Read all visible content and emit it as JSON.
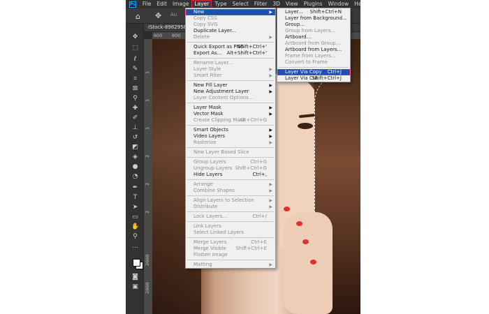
{
  "app": {
    "logo": "Ps",
    "menubar": [
      "File",
      "Edit",
      "Image",
      "Layer",
      "Type",
      "Select",
      "Filter",
      "3D",
      "View",
      "Plugins",
      "Window",
      "Help"
    ],
    "active_menu": "Layer"
  },
  "options_bar": {
    "auto_label": "Au"
  },
  "document": {
    "tab_label": "iStock-89829585",
    "ruler_marks": [
      "600",
      "800"
    ],
    "vruler_marks": [
      "1",
      "1",
      "1",
      "2",
      "2",
      "2",
      "2600",
      "2800"
    ]
  },
  "layer_menu": [
    {
      "label": "New",
      "arrow": "▶",
      "state": "selected"
    },
    {
      "label": "Copy CSS",
      "state": "disabled"
    },
    {
      "label": "Copy SVG",
      "state": "disabled"
    },
    {
      "label": "Duplicate Layer...",
      "state": "enabled"
    },
    {
      "label": "Delete",
      "arrow": "▶",
      "state": "disabled"
    },
    {
      "sep": true
    },
    {
      "label": "Quick Export as PNG",
      "shortcut": "Shift+Ctrl+'",
      "state": "enabled"
    },
    {
      "label": "Export As...",
      "shortcut": "Alt+Shift+Ctrl+'",
      "state": "enabled"
    },
    {
      "sep": true
    },
    {
      "label": "Rename Layer...",
      "state": "disabled"
    },
    {
      "label": "Layer Style",
      "arrow": "▶",
      "state": "disabled"
    },
    {
      "label": "Smart Filter",
      "arrow": "▶",
      "state": "disabled"
    },
    {
      "sep": true
    },
    {
      "label": "New Fill Layer",
      "arrow": "▶",
      "state": "enabled"
    },
    {
      "label": "New Adjustment Layer",
      "arrow": "▶",
      "state": "enabled"
    },
    {
      "label": "Layer Content Options...",
      "state": "disabled"
    },
    {
      "sep": true
    },
    {
      "label": "Layer Mask",
      "arrow": "▶",
      "state": "enabled"
    },
    {
      "label": "Vector Mask",
      "arrow": "▶",
      "state": "enabled"
    },
    {
      "label": "Create Clipping Mask",
      "shortcut": "Alt+Ctrl+G",
      "state": "disabled"
    },
    {
      "sep": true
    },
    {
      "label": "Smart Objects",
      "arrow": "▶",
      "state": "enabled"
    },
    {
      "label": "Video Layers",
      "arrow": "▶",
      "state": "enabled"
    },
    {
      "label": "Rasterize",
      "arrow": "▶",
      "state": "disabled"
    },
    {
      "sep": true
    },
    {
      "label": "New Layer Based Slice",
      "state": "disabled"
    },
    {
      "sep": true
    },
    {
      "label": "Group Layers",
      "shortcut": "Ctrl+G",
      "state": "disabled"
    },
    {
      "label": "Ungroup Layers",
      "shortcut": "Shift+Ctrl+G",
      "state": "disabled"
    },
    {
      "label": "Hide Layers",
      "shortcut": "Ctrl+,",
      "state": "enabled"
    },
    {
      "sep": true
    },
    {
      "label": "Arrange",
      "arrow": "▶",
      "state": "disabled"
    },
    {
      "label": "Combine Shapes",
      "arrow": "▶",
      "state": "disabled"
    },
    {
      "sep": true
    },
    {
      "label": "Align Layers to Selection",
      "arrow": "▶",
      "state": "disabled"
    },
    {
      "label": "Distribute",
      "arrow": "▶",
      "state": "disabled"
    },
    {
      "sep": true
    },
    {
      "label": "Lock Layers...",
      "shortcut": "Ctrl+/",
      "state": "disabled"
    },
    {
      "sep": true
    },
    {
      "label": "Link Layers",
      "state": "disabled"
    },
    {
      "label": "Select Linked Layers",
      "state": "disabled"
    },
    {
      "sep": true
    },
    {
      "label": "Merge Layers",
      "shortcut": "Ctrl+E",
      "state": "disabled"
    },
    {
      "label": "Merge Visible",
      "shortcut": "Shift+Ctrl+E",
      "state": "disabled"
    },
    {
      "label": "Flatten Image",
      "state": "disabled"
    },
    {
      "sep": true
    },
    {
      "label": "Matting",
      "arrow": "▶",
      "state": "disabled"
    }
  ],
  "new_menu": [
    {
      "label": "Layer...",
      "shortcut": "Shift+Ctrl+N",
      "state": "enabled"
    },
    {
      "label": "Layer from Background...",
      "state": "enabled"
    },
    {
      "label": "Group...",
      "state": "enabled"
    },
    {
      "label": "Group from Layers...",
      "state": "disabled"
    },
    {
      "label": "Artboard...",
      "state": "enabled"
    },
    {
      "label": "Artboard from Group...",
      "state": "disabled"
    },
    {
      "label": "Artboard from Layers...",
      "state": "enabled"
    },
    {
      "label": "Frame from Layers...",
      "state": "disabled"
    },
    {
      "label": "Convert to Frame",
      "state": "disabled"
    },
    {
      "sep": true
    },
    {
      "label": "Layer Via Copy",
      "shortcut": "Ctrl+J",
      "state": "highlighted"
    },
    {
      "label": "Layer Via Cut",
      "shortcut": "Shift+Ctrl+J",
      "state": "enabled"
    }
  ],
  "colors": {
    "menu_highlight": "#1f4fb4",
    "annotation_red": "#e0263b",
    "nail_red": "#e3302f"
  }
}
